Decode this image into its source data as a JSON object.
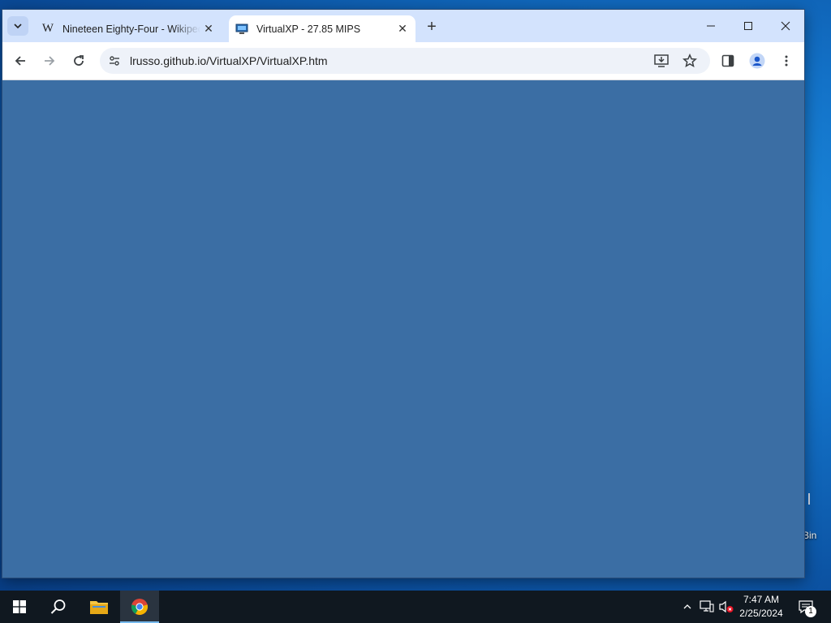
{
  "browser": {
    "tabs": [
      {
        "title": "Nineteen Eighty-Four - Wikipedia",
        "favicon": "W",
        "active": false
      },
      {
        "title": "VirtualXP - 27.85 MIPS",
        "active": true
      }
    ],
    "address": {
      "url": "lrusso.github.io/VirtualXP/VirtualXP.htm"
    },
    "content_color": "#3b6ea4"
  },
  "desktop": {
    "recycle_bin_label_fragment": "Bin"
  },
  "taskbar": {
    "time": "7:47 AM",
    "date": "2/25/2024",
    "notification_count": "1"
  }
}
